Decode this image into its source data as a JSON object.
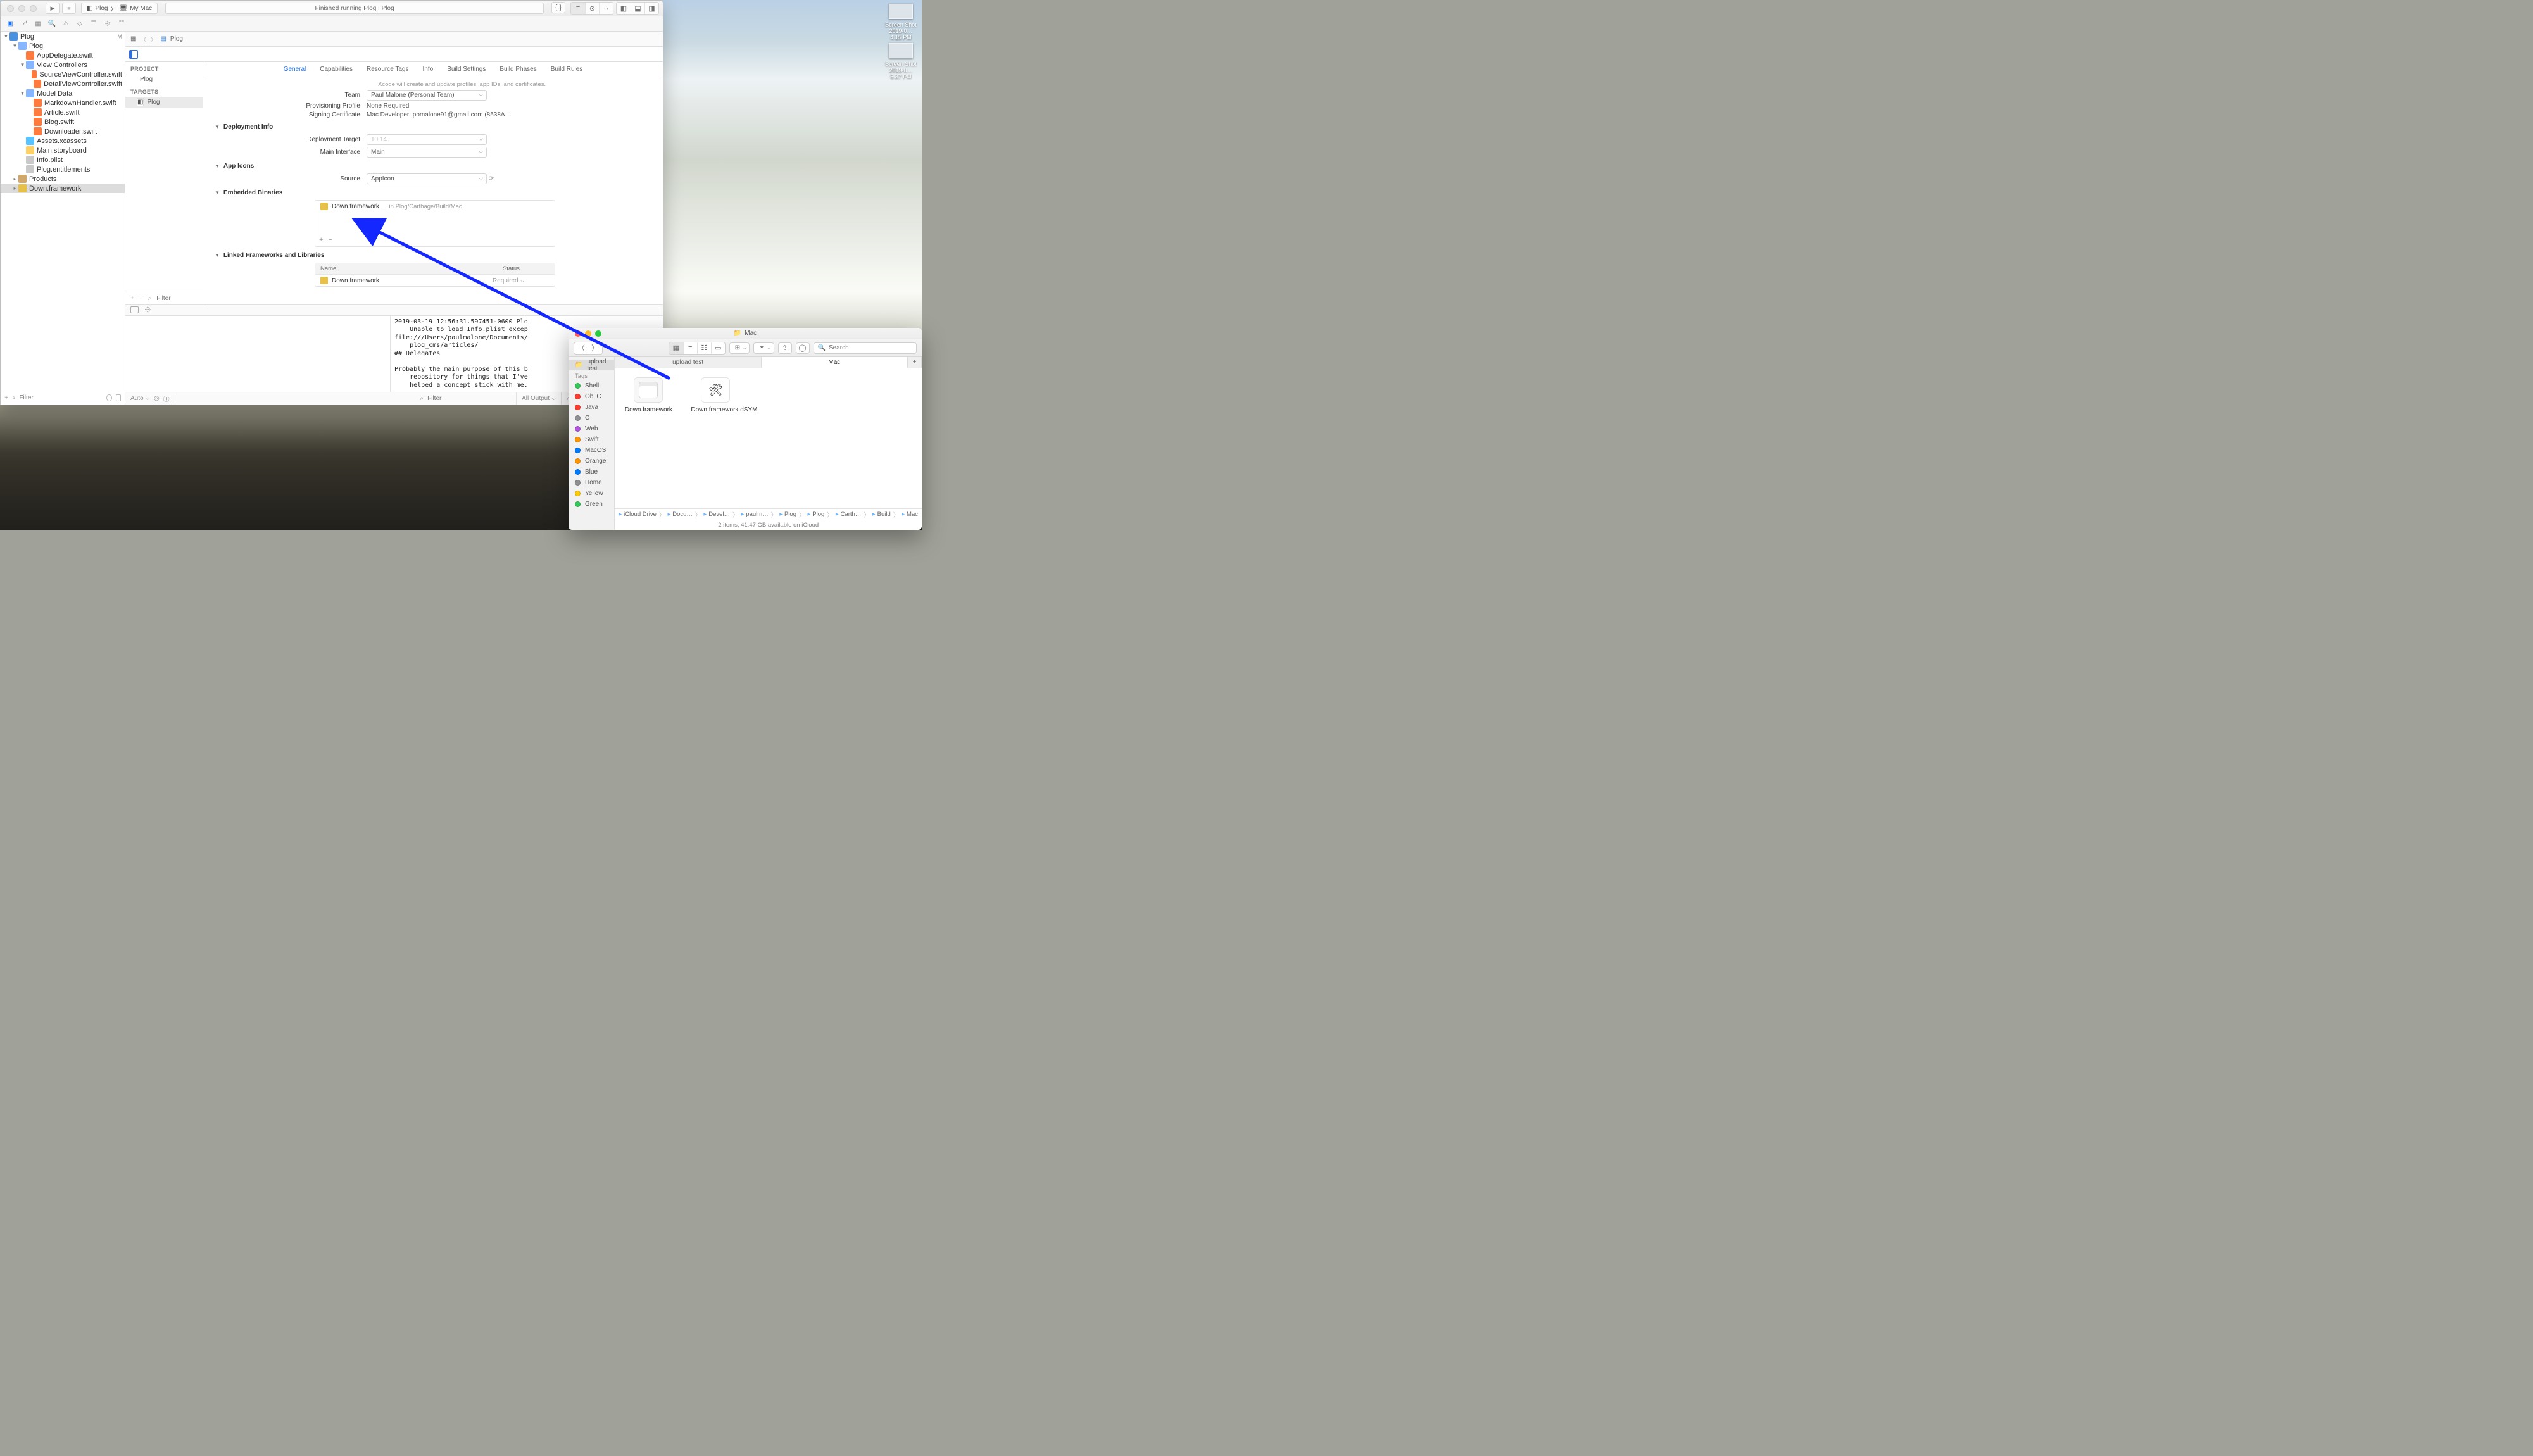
{
  "xcode": {
    "scheme": {
      "app": "Plog",
      "dest": "My Mac"
    },
    "status": "Finished running Plog : Plog",
    "jump": {
      "crumb": "Plog"
    },
    "navigator": {
      "root": "Plog",
      "root_badge": "M",
      "items": [
        {
          "t": "folder",
          "l": "Plog",
          "d": 1
        },
        {
          "t": "swift",
          "l": "AppDelegate.swift",
          "d": 2
        },
        {
          "t": "folder",
          "l": "View Controllers",
          "d": 2
        },
        {
          "t": "swift",
          "l": "SourceViewController.swift",
          "d": 3
        },
        {
          "t": "swift",
          "l": "DetailViewController.swift",
          "d": 3
        },
        {
          "t": "folder",
          "l": "Model Data",
          "d": 2
        },
        {
          "t": "swift",
          "l": "MarkdownHandler.swift",
          "d": 3
        },
        {
          "t": "swift",
          "l": "Article.swift",
          "d": 3
        },
        {
          "t": "swift",
          "l": "Blog.swift",
          "d": 3
        },
        {
          "t": "swift",
          "l": "Downloader.swift",
          "d": 3
        },
        {
          "t": "asset",
          "l": "Assets.xcassets",
          "d": 2
        },
        {
          "t": "sb",
          "l": "Main.storyboard",
          "d": 2
        },
        {
          "t": "plist",
          "l": "Info.plist",
          "d": 2
        },
        {
          "t": "ent",
          "l": "Plog.entitlements",
          "d": 2
        },
        {
          "t": "prod",
          "l": "Products",
          "d": 1
        },
        {
          "t": "fw",
          "l": "Down.framework",
          "d": 1,
          "sel": true
        }
      ],
      "filter_placeholder": "Filter"
    },
    "targets": {
      "project_header": "PROJECT",
      "project_name": "Plog",
      "targets_header": "TARGETS",
      "target_name": "Plog",
      "filter_placeholder": "Filter"
    },
    "tabs": [
      "General",
      "Capabilities",
      "Resource Tags",
      "Info",
      "Build Settings",
      "Build Phases",
      "Build Rules"
    ],
    "active_tab": "General",
    "signing": {
      "note": "Xcode will create and update profiles, app IDs, and certificates.",
      "team_label": "Team",
      "team_value": "Paul Malone (Personal Team)",
      "prov_label": "Provisioning Profile",
      "prov_value": "None Required",
      "cert_label": "Signing Certificate",
      "cert_value": "Mac Developer: pomalone91@gmail.com (8538A…"
    },
    "deploy": {
      "header": "Deployment Info",
      "target_label": "Deployment Target",
      "target_value": "10.14",
      "main_label": "Main Interface",
      "main_value": "Main"
    },
    "appicons": {
      "header": "App Icons",
      "source_label": "Source",
      "source_value": "AppIcon"
    },
    "embedded": {
      "header": "Embedded Binaries",
      "name": "Down.framework",
      "path": "…in Plog/Carthage/Build/Mac"
    },
    "linked": {
      "header": "Linked Frameworks and Libraries",
      "col_name": "Name",
      "col_status": "Status",
      "name": "Down.framework",
      "status": "Required"
    },
    "console": {
      "lines": "2019-03-19 12:56:31.597451-0600 Plo\n    Unable to load Info.plist excep\nfile:///Users/paulmalone/Documents/\n    plog_cms/articles/\n## Delegates\n\nProbably the main purpose of this b\n    repository for things that I've\n    helped a concept stick with me.",
      "auto": "Auto",
      "all_output": "All Output",
      "filter_placeholder": "Filter"
    }
  },
  "finder": {
    "title": "Mac",
    "search_placeholder": "Search",
    "sidebar": {
      "section1": "upload test",
      "tags_header": "Tags",
      "tags": [
        {
          "c": "#34c759",
          "l": "Shell"
        },
        {
          "c": "#ff3b30",
          "l": "Obj C"
        },
        {
          "c": "#ff3b30",
          "l": "Java"
        },
        {
          "c": "#8e8e93",
          "l": "C"
        },
        {
          "c": "#af52de",
          "l": "Web"
        },
        {
          "c": "#ff9500",
          "l": "Swift"
        },
        {
          "c": "#007aff",
          "l": "MacOS"
        },
        {
          "c": "#ff9500",
          "l": "Orange"
        },
        {
          "c": "#007aff",
          "l": "Blue"
        },
        {
          "c": "#8e8e93",
          "l": "Home"
        },
        {
          "c": "#ffcc00",
          "l": "Yellow"
        },
        {
          "c": "#34c759",
          "l": "Green"
        }
      ]
    },
    "tabs": {
      "t1": "upload test",
      "t2": "Mac"
    },
    "items": [
      {
        "name": "Down.framework",
        "kind": "fw"
      },
      {
        "name": "Down.framework.dSYM",
        "kind": "dsym"
      }
    ],
    "path": [
      "iCloud Drive",
      "Docu…",
      "Devel…",
      "paulm…",
      "Plog",
      "Plog",
      "Carth…",
      "Build",
      "Mac"
    ],
    "status": "2 items, 41.47 GB available on iCloud"
  },
  "desktop": {
    "shot1": {
      "t": "Screen Shot",
      "d": "2019-0…4.15 PM"
    },
    "shot2": {
      "t": "Screen Shot",
      "d": "2019-0…5.37 PM"
    }
  }
}
